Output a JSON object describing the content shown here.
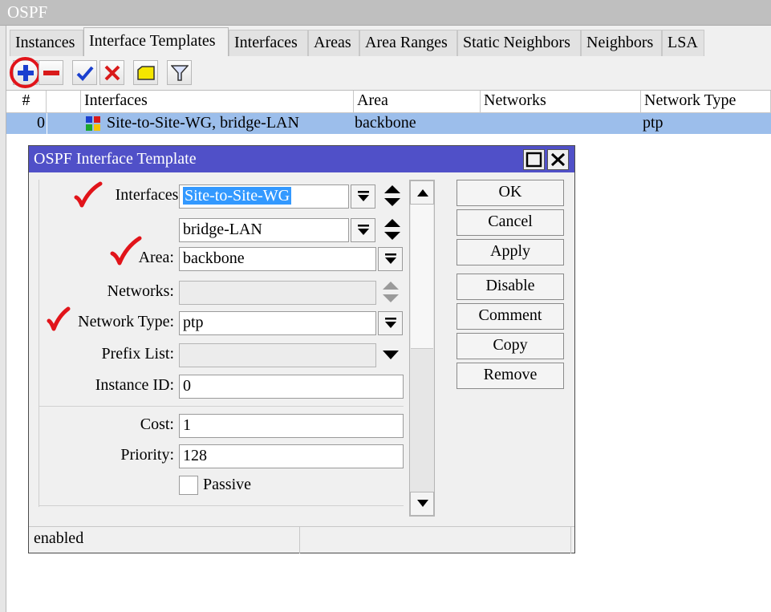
{
  "window": {
    "title": "OSPF"
  },
  "tabs": [
    {
      "label": "Instances"
    },
    {
      "label": "Interface Templates",
      "active": true
    },
    {
      "label": "Interfaces"
    },
    {
      "label": "Areas"
    },
    {
      "label": "Area Ranges"
    },
    {
      "label": "Static Neighbors"
    },
    {
      "label": "Neighbors"
    },
    {
      "label": "LSA"
    }
  ],
  "toolbar": {
    "buttons": [
      "add-icon",
      "remove-icon",
      "enable-check-icon",
      "disable-x-icon",
      "comment-note-icon",
      "filter-icon"
    ],
    "highlight_color": "#e1141a"
  },
  "table": {
    "columns": [
      "#",
      "",
      "Interfaces",
      "Area",
      "Networks",
      "Network Type"
    ],
    "rows": [
      {
        "index": "0",
        "interfaces": "Site-to-Site-WG, bridge-LAN",
        "area": "backbone",
        "networks": "",
        "network_type": "ptp"
      }
    ],
    "selected_row_color": "#9cbeeb"
  },
  "dialog": {
    "title": "OSPF Interface Template",
    "labels": {
      "interfaces": "Interfaces:",
      "area": "Area:",
      "networks": "Networks:",
      "network_type": "Network Type:",
      "prefix_list": "Prefix List:",
      "instance_id": "Instance ID:",
      "cost": "Cost:",
      "priority": "Priority:",
      "passive": "Passive"
    },
    "values": {
      "interface_1": "Site-to-Site-WG",
      "interface_2": "bridge-LAN",
      "area": "backbone",
      "networks": "",
      "network_type": "ptp",
      "prefix_list": "",
      "instance_id": "0",
      "cost": "1",
      "priority": "128",
      "passive": false
    },
    "buttons": {
      "ok": "OK",
      "cancel": "Cancel",
      "apply": "Apply",
      "disable": "Disable",
      "comment": "Comment",
      "copy": "Copy",
      "remove": "Remove"
    },
    "status": {
      "left": "enabled",
      "right": ""
    },
    "title_bar_color": "#5050c8",
    "annotation_color": "#e1141a"
  }
}
